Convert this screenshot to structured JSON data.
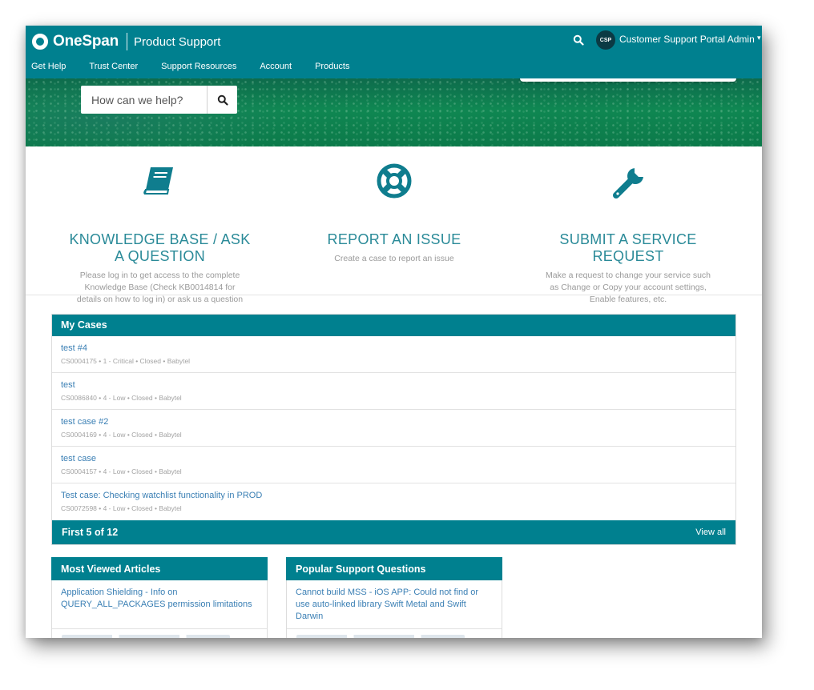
{
  "header": {
    "brand": "OneSpan",
    "subtitle": "Product Support",
    "user_initials": "CSP",
    "user_name": "Customer Support Portal Admin",
    "nav": [
      "Get Help",
      "Trust Center",
      "Support Resources",
      "Account",
      "Products"
    ]
  },
  "hero": {
    "search_placeholder": "How can we help?"
  },
  "features": [
    {
      "icon": "book-icon",
      "title_line1": "KNOWLEDGE BASE / ASK",
      "title_line2": "A QUESTION",
      "desc_lines": [
        "Please log in to get access to the complete",
        "Knowledge Base (Check KB0014814 for",
        "details on how to log in) or ask us a question"
      ]
    },
    {
      "icon": "lifebuoy-icon",
      "title_line1": "REPORT AN ISSUE",
      "title_line2": "",
      "desc_lines": [
        "Create a case to report an issue"
      ]
    },
    {
      "icon": "wrench-icon",
      "title_line1": "SUBMIT A SERVICE",
      "title_line2": "REQUEST",
      "desc_lines": [
        "Make a request to change your service such",
        "as Change or Copy your account settings,",
        "Enable features, etc."
      ]
    }
  ],
  "cases": {
    "title": "My Cases",
    "rows": [
      {
        "title": "test #4",
        "meta": "CS0004175 • 1 - Critical • Closed • Babytel"
      },
      {
        "title": "test",
        "meta": "CS0086840 • 4 - Low • Closed • Babytel"
      },
      {
        "title": "test case #2",
        "meta": "CS0004169 • 4 - Low • Closed • Babytel"
      },
      {
        "title": "test case",
        "meta": "CS0004157 • 4 - Low • Closed • Babytel"
      },
      {
        "title": "Test case: Checking watchlist functionality in PROD",
        "meta": "CS0072598 • 4 - Low • Closed • Babytel"
      }
    ],
    "footer_count": "First 5 of 12",
    "view_all": "View all"
  },
  "most_viewed": {
    "title": "Most Viewed Articles",
    "first_item": "Application Shielding - Info on QUERY_ALL_PACKAGES permission limitations"
  },
  "popular": {
    "title": "Popular Support Questions",
    "first_item": "Cannot build MSS - iOS APP: Could not find or use auto-linked library Swift Metal and Swift Darwin"
  },
  "colors": {
    "header": "#00808f",
    "accent_text": "#2a8a98",
    "link": "#3a7fb4"
  }
}
